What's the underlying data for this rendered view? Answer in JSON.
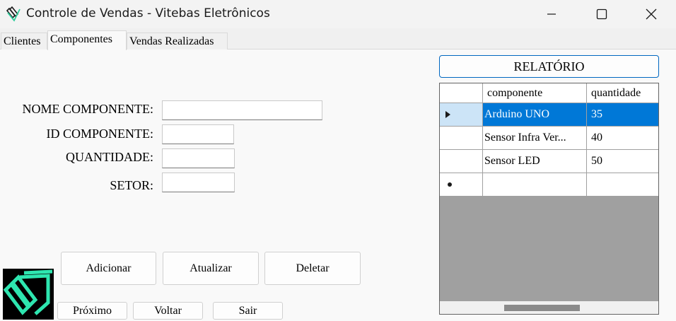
{
  "window": {
    "title": "Controle de Vendas - Vitebas Eletrônicos",
    "icon": "app-logo-icon",
    "accent": "#0078d7"
  },
  "tabs": [
    {
      "label": "Clientes",
      "active": false
    },
    {
      "label": "Componentes",
      "active": true
    },
    {
      "label": "Vendas Realizadas",
      "active": false
    }
  ],
  "form": {
    "nome_label": "NOME COMPONENTE:",
    "nome_value": "",
    "id_label": "ID COMPONENTE:",
    "id_value": "",
    "quantidade_label": "QUANTIDADE:",
    "quantidade_value": "",
    "setor_label": "SETOR:",
    "setor_value": ""
  },
  "actions": {
    "adicionar": "Adicionar",
    "atualizar": "Atualizar",
    "deletar": "Deletar",
    "proximo": "Próximo",
    "voltar": "Voltar",
    "sair": "Sair",
    "relatorio": "RELATÓRIO"
  },
  "grid": {
    "columns": [
      "componente",
      "quantidade"
    ],
    "rows": [
      {
        "componente": "Arduino UNO",
        "quantidade": "35",
        "selected": true
      },
      {
        "componente": "Sensor Infra Ver...",
        "quantidade": "40",
        "selected": false
      },
      {
        "componente": "Sensor LED",
        "quantidade": "50",
        "selected": false
      }
    ],
    "new_row_marker": "new-row-star-icon",
    "current_row_marker": "row-pointer-icon"
  }
}
